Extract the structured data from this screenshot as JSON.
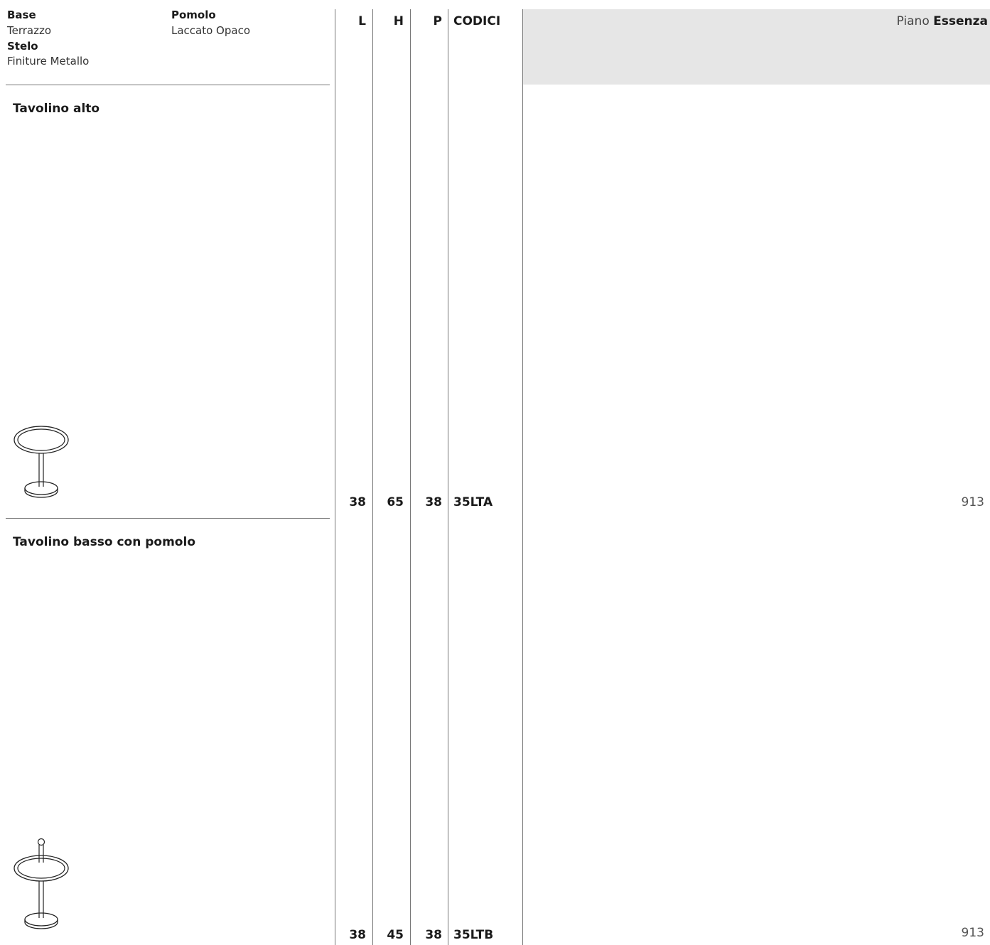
{
  "header": {
    "base_label": "Base",
    "base_value": "Terrazzo",
    "stelo_label": "Stelo",
    "stelo_value": "Finiture Metallo",
    "pomolo_label": "Pomolo",
    "pomolo_value": "Laccato Opaco"
  },
  "columns": {
    "l": "L",
    "h": "H",
    "p": "P",
    "codes": "CODICI"
  },
  "finish_panel": {
    "prefix": "Piano",
    "name": "Essenza",
    "background": "#e6e6e6"
  },
  "products": [
    {
      "title": "Tavolino alto",
      "icon": "high-table-icon",
      "l": "38",
      "h": "65",
      "p": "38",
      "code": "35LTA",
      "price": "913"
    },
    {
      "title": "Tavolino basso con pomolo",
      "icon": "low-table-with-knob-icon",
      "l": "38",
      "h": "45",
      "p": "38",
      "code": "35LTB",
      "price": "913"
    }
  ]
}
